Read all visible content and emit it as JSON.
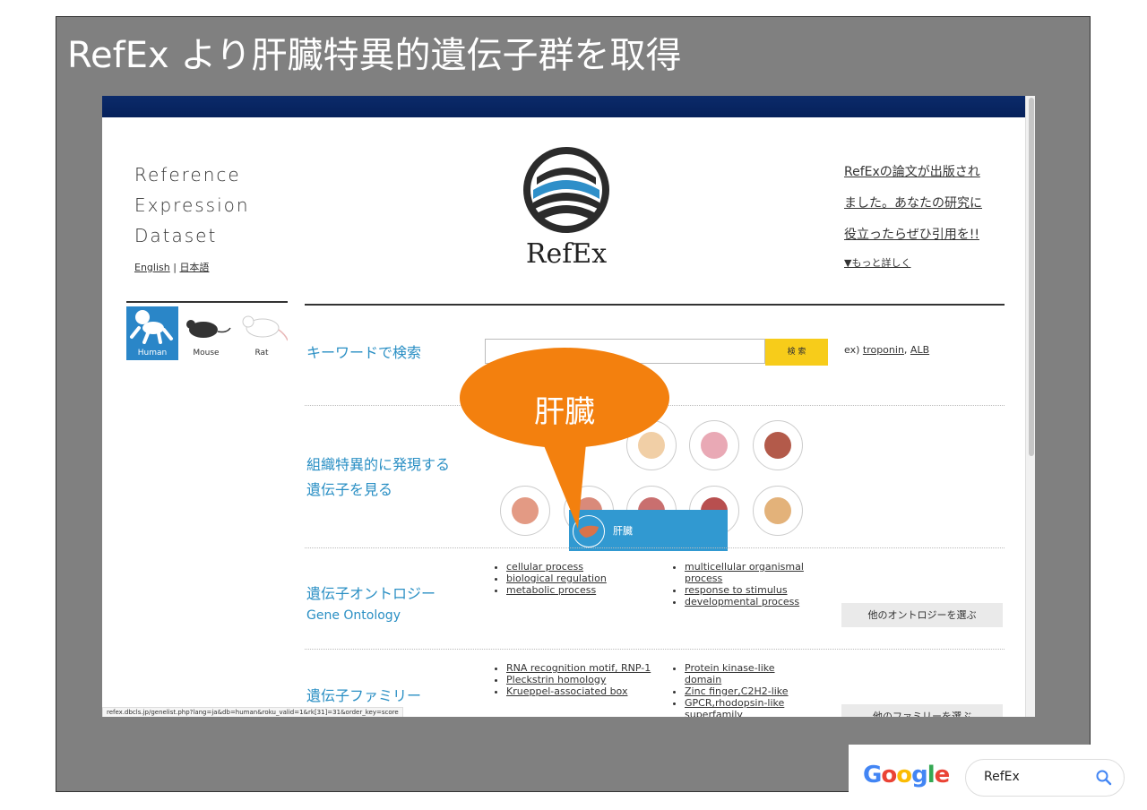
{
  "slide": {
    "title": "RefEx より肝臓特異的遺伝子群を取得"
  },
  "refex": {
    "brand_line1": "Reference",
    "brand_line2": "Expression",
    "brand_line3": "Dataset",
    "lang_english": "English",
    "lang_sep": " | ",
    "lang_japanese": "日本語",
    "logo_text": "RefEx",
    "notice_line1": "RefExの論文が出版され",
    "notice_line2": "ました。あなたの研究に",
    "notice_line3": "役立ったらぜひ引用を!!",
    "notice_more": "▼もっと詳しく",
    "species": [
      {
        "label": "Human"
      },
      {
        "label": "Mouse"
      },
      {
        "label": "Rat"
      }
    ],
    "keyword_label": "キーワードで検索",
    "search_button": "検 索",
    "examples_prefix": "ex) ",
    "example1": "troponin",
    "examples_comma": ", ",
    "example2": "ALB",
    "tissue_label_line1": "組織特異的に発現する",
    "tissue_label_line2": "遺伝子を見る",
    "tooltip_label": "肝臓",
    "go_label_jp": "遺伝子オントロジー",
    "go_label_en": "Gene Ontology",
    "go_col1": [
      "cellular process",
      "biological regulation",
      "metabolic process"
    ],
    "go_col2": [
      "multicellular organismal process",
      "response to stimulus",
      "developmental process"
    ],
    "go_select": "他のオントロジーを選ぶ",
    "family_label": "遺伝子ファミリー",
    "family_col1": [
      "RNA recognition motif, RNP-1",
      "Pleckstrin homology",
      "Krueppel-associated box"
    ],
    "family_col2": [
      "Protein kinase-like domain",
      "Zinc finger,C2H2-like",
      "GPCR,rhodopsin-like superfamily"
    ],
    "family_select": "他のファミリーを選ぶ",
    "status_url": "refex.dbcls.jp/genelist.php?lang=ja&db=human&roku_valid=1&rk[31]=31&order_key=score"
  },
  "callout": {
    "text": "肝臓",
    "color": "#f3800e"
  },
  "google": {
    "logo": "Google",
    "query": "RefEx"
  }
}
